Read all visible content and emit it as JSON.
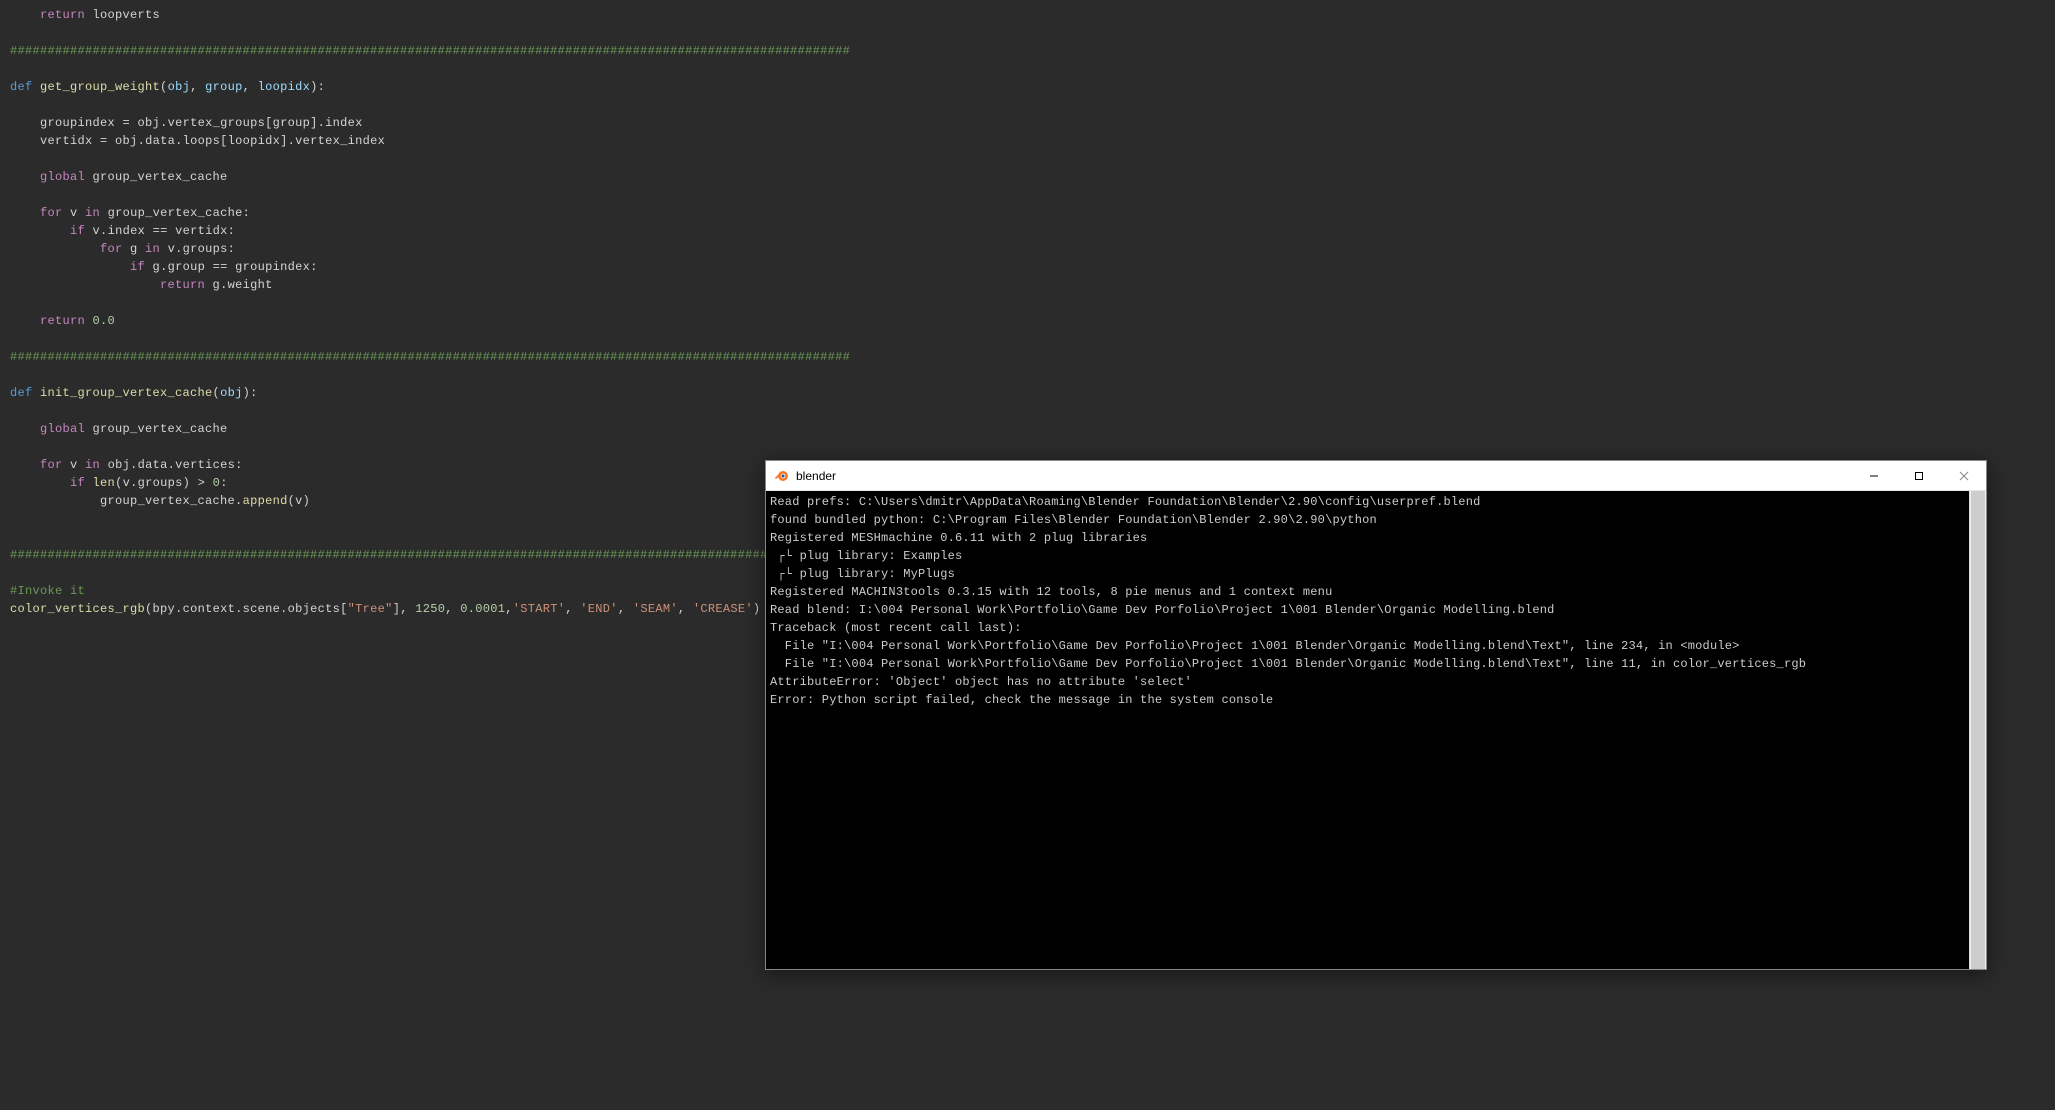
{
  "editor": {
    "lines": [
      {
        "t": "    ",
        "spans": [
          {
            "c": "kw-return",
            "t": "return"
          },
          {
            "c": "ident",
            "t": " loopverts"
          }
        ]
      },
      {
        "t": "",
        "spans": []
      },
      {
        "t": "",
        "spans": [
          {
            "c": "sep-line",
            "t": "################################################################################################################"
          }
        ]
      },
      {
        "t": "",
        "spans": []
      },
      {
        "t": "",
        "spans": [
          {
            "c": "kw-def",
            "t": "def "
          },
          {
            "c": "fn",
            "t": "get_group_weight"
          },
          {
            "c": "punct",
            "t": "("
          },
          {
            "c": "param",
            "t": "obj"
          },
          {
            "c": "punct",
            "t": ", "
          },
          {
            "c": "param",
            "t": "group"
          },
          {
            "c": "punct",
            "t": ", "
          },
          {
            "c": "param",
            "t": "loopidx"
          },
          {
            "c": "punct",
            "t": "):"
          }
        ]
      },
      {
        "t": "",
        "spans": []
      },
      {
        "t": "    ",
        "spans": [
          {
            "c": "ident",
            "t": "groupindex "
          },
          {
            "c": "op",
            "t": "="
          },
          {
            "c": "ident",
            "t": " obj"
          },
          {
            "c": "punct",
            "t": "."
          },
          {
            "c": "ident",
            "t": "vertex_groups"
          },
          {
            "c": "punct",
            "t": "["
          },
          {
            "c": "ident",
            "t": "group"
          },
          {
            "c": "punct",
            "t": "]."
          },
          {
            "c": "ident",
            "t": "index"
          }
        ]
      },
      {
        "t": "    ",
        "spans": [
          {
            "c": "ident",
            "t": "vertidx "
          },
          {
            "c": "op",
            "t": "="
          },
          {
            "c": "ident",
            "t": " obj"
          },
          {
            "c": "punct",
            "t": "."
          },
          {
            "c": "ident",
            "t": "data"
          },
          {
            "c": "punct",
            "t": "."
          },
          {
            "c": "ident",
            "t": "loops"
          },
          {
            "c": "punct",
            "t": "["
          },
          {
            "c": "ident",
            "t": "loopidx"
          },
          {
            "c": "punct",
            "t": "]."
          },
          {
            "c": "ident",
            "t": "vertex_index"
          }
        ]
      },
      {
        "t": "",
        "spans": []
      },
      {
        "t": "    ",
        "spans": [
          {
            "c": "kw-global",
            "t": "global"
          },
          {
            "c": "ident",
            "t": " group_vertex_cache"
          }
        ]
      },
      {
        "t": "",
        "spans": []
      },
      {
        "t": "    ",
        "spans": [
          {
            "c": "kw-for",
            "t": "for"
          },
          {
            "c": "ident",
            "t": " v "
          },
          {
            "c": "kw-in",
            "t": "in"
          },
          {
            "c": "ident",
            "t": " group_vertex_cache"
          },
          {
            "c": "punct",
            "t": ":"
          }
        ]
      },
      {
        "t": "        ",
        "spans": [
          {
            "c": "kw-if",
            "t": "if"
          },
          {
            "c": "ident",
            "t": " v"
          },
          {
            "c": "punct",
            "t": "."
          },
          {
            "c": "ident",
            "t": "index "
          },
          {
            "c": "op",
            "t": "=="
          },
          {
            "c": "ident",
            "t": " vertidx"
          },
          {
            "c": "punct",
            "t": ":"
          }
        ]
      },
      {
        "t": "            ",
        "spans": [
          {
            "c": "kw-for",
            "t": "for"
          },
          {
            "c": "ident",
            "t": " g "
          },
          {
            "c": "kw-in",
            "t": "in"
          },
          {
            "c": "ident",
            "t": " v"
          },
          {
            "c": "punct",
            "t": "."
          },
          {
            "c": "ident",
            "t": "groups"
          },
          {
            "c": "punct",
            "t": ":"
          }
        ]
      },
      {
        "t": "                ",
        "spans": [
          {
            "c": "kw-if",
            "t": "if"
          },
          {
            "c": "ident",
            "t": " g"
          },
          {
            "c": "punct",
            "t": "."
          },
          {
            "c": "ident",
            "t": "group "
          },
          {
            "c": "op",
            "t": "=="
          },
          {
            "c": "ident",
            "t": " groupindex"
          },
          {
            "c": "punct",
            "t": ":"
          }
        ]
      },
      {
        "t": "                    ",
        "spans": [
          {
            "c": "kw-return",
            "t": "return"
          },
          {
            "c": "ident",
            "t": " g"
          },
          {
            "c": "punct",
            "t": "."
          },
          {
            "c": "ident",
            "t": "weight"
          }
        ]
      },
      {
        "t": "",
        "spans": []
      },
      {
        "t": "    ",
        "spans": [
          {
            "c": "kw-return",
            "t": "return"
          },
          {
            "c": "ident",
            "t": " "
          },
          {
            "c": "num",
            "t": "0.0"
          }
        ]
      },
      {
        "t": "",
        "spans": []
      },
      {
        "t": "",
        "spans": [
          {
            "c": "sep-line",
            "t": "################################################################################################################"
          }
        ]
      },
      {
        "t": "",
        "spans": []
      },
      {
        "t": "",
        "spans": [
          {
            "c": "kw-def",
            "t": "def "
          },
          {
            "c": "fn",
            "t": "init_group_vertex_cache"
          },
          {
            "c": "punct",
            "t": "("
          },
          {
            "c": "param",
            "t": "obj"
          },
          {
            "c": "punct",
            "t": "):"
          }
        ]
      },
      {
        "t": "",
        "spans": []
      },
      {
        "t": "    ",
        "spans": [
          {
            "c": "kw-global",
            "t": "global"
          },
          {
            "c": "ident",
            "t": " group_vertex_cache"
          }
        ]
      },
      {
        "t": "",
        "spans": []
      },
      {
        "t": "    ",
        "spans": [
          {
            "c": "kw-for",
            "t": "for"
          },
          {
            "c": "ident",
            "t": " v "
          },
          {
            "c": "kw-in",
            "t": "in"
          },
          {
            "c": "ident",
            "t": " obj"
          },
          {
            "c": "punct",
            "t": "."
          },
          {
            "c": "ident",
            "t": "data"
          },
          {
            "c": "punct",
            "t": "."
          },
          {
            "c": "ident",
            "t": "vertices"
          },
          {
            "c": "punct",
            "t": ":"
          }
        ]
      },
      {
        "t": "        ",
        "spans": [
          {
            "c": "kw-if",
            "t": "if"
          },
          {
            "c": "ident",
            "t": " "
          },
          {
            "c": "fn",
            "t": "len"
          },
          {
            "c": "punct",
            "t": "("
          },
          {
            "c": "ident",
            "t": "v"
          },
          {
            "c": "punct",
            "t": "."
          },
          {
            "c": "ident",
            "t": "groups"
          },
          {
            "c": "punct",
            "t": ") "
          },
          {
            "c": "op",
            "t": ">"
          },
          {
            "c": "ident",
            "t": " "
          },
          {
            "c": "num",
            "t": "0"
          },
          {
            "c": "punct",
            "t": ":"
          }
        ]
      },
      {
        "t": "            ",
        "spans": [
          {
            "c": "ident",
            "t": "group_vertex_cache"
          },
          {
            "c": "punct",
            "t": "."
          },
          {
            "c": "fn",
            "t": "append"
          },
          {
            "c": "punct",
            "t": "("
          },
          {
            "c": "ident",
            "t": "v"
          },
          {
            "c": "punct",
            "t": ")"
          }
        ]
      },
      {
        "t": "",
        "spans": []
      },
      {
        "t": "",
        "spans": []
      },
      {
        "t": "",
        "spans": [
          {
            "c": "sep-line",
            "t": "################################################################################################################"
          }
        ]
      },
      {
        "t": "",
        "spans": []
      },
      {
        "t": "",
        "spans": [
          {
            "c": "comment",
            "t": "#Invoke it"
          }
        ]
      },
      {
        "t": "",
        "spans": [
          {
            "c": "fn",
            "t": "color_vertices_rgb"
          },
          {
            "c": "punct",
            "t": "("
          },
          {
            "c": "ident",
            "t": "bpy"
          },
          {
            "c": "punct",
            "t": "."
          },
          {
            "c": "ident",
            "t": "context"
          },
          {
            "c": "punct",
            "t": "."
          },
          {
            "c": "ident",
            "t": "scene"
          },
          {
            "c": "punct",
            "t": "."
          },
          {
            "c": "ident",
            "t": "objects"
          },
          {
            "c": "punct",
            "t": "["
          },
          {
            "c": "str",
            "t": "\"Tree\""
          },
          {
            "c": "punct",
            "t": "], "
          },
          {
            "c": "num",
            "t": "1250"
          },
          {
            "c": "punct",
            "t": ", "
          },
          {
            "c": "num",
            "t": "0.0001"
          },
          {
            "c": "punct",
            "t": ","
          },
          {
            "c": "str",
            "t": "'START'"
          },
          {
            "c": "punct",
            "t": ", "
          },
          {
            "c": "str",
            "t": "'END'"
          },
          {
            "c": "punct",
            "t": ", "
          },
          {
            "c": "str",
            "t": "'SEAM'"
          },
          {
            "c": "punct",
            "t": ", "
          },
          {
            "c": "str",
            "t": "'CREASE'"
          },
          {
            "c": "punct",
            "t": ")"
          }
        ]
      }
    ]
  },
  "console": {
    "title": "blender",
    "lines": [
      "Read prefs: C:\\Users\\dmitr\\AppData\\Roaming\\Blender Foundation\\Blender\\2.90\\config\\userpref.blend",
      "found bundled python: C:\\Program Files\\Blender Foundation\\Blender 2.90\\2.90\\python",
      "Registered MESHmachine 0.6.11 with 2 plug libraries",
      " ┌└ plug library: Examples",
      " ┌└ plug library: MyPlugs",
      "Registered MACHIN3tools 0.3.15 with 12 tools, 8 pie menus and 1 context menu",
      "Read blend: I:\\004 Personal Work\\Portfolio\\Game Dev Porfolio\\Project 1\\001 Blender\\Organic Modelling.blend",
      "Traceback (most recent call last):",
      "  File \"I:\\004 Personal Work\\Portfolio\\Game Dev Porfolio\\Project 1\\001 Blender\\Organic Modelling.blend\\Text\", line 234, in <module>",
      "  File \"I:\\004 Personal Work\\Portfolio\\Game Dev Porfolio\\Project 1\\001 Blender\\Organic Modelling.blend\\Text\", line 11, in color_vertices_rgb",
      "AttributeError: 'Object' object has no attribute 'select'",
      "Error: Python script failed, check the message in the system console"
    ]
  }
}
